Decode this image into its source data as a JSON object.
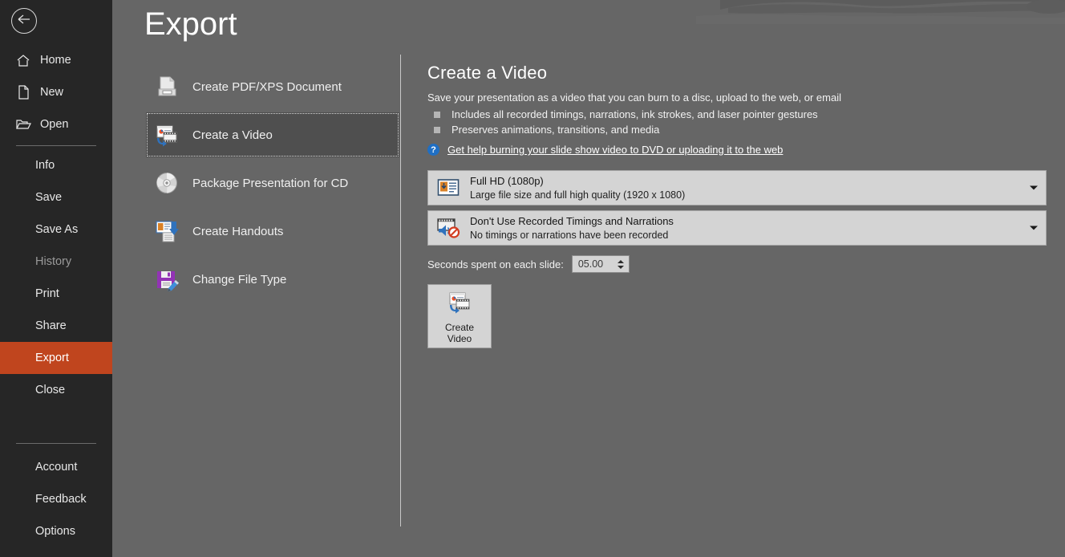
{
  "window": {
    "title": "Export"
  },
  "nav": {
    "back_icon": "back-arrow-icon",
    "top_items": [
      {
        "label": "Home",
        "icon": "home-icon"
      },
      {
        "label": "New",
        "icon": "new-document-icon"
      },
      {
        "label": "Open",
        "icon": "open-folder-icon"
      }
    ],
    "mid_items": [
      {
        "label": "Info",
        "state": "normal"
      },
      {
        "label": "Save",
        "state": "normal"
      },
      {
        "label": "Save As",
        "state": "normal"
      },
      {
        "label": "History",
        "state": "disabled"
      },
      {
        "label": "Print",
        "state": "normal"
      },
      {
        "label": "Share",
        "state": "normal"
      },
      {
        "label": "Export",
        "state": "selected"
      },
      {
        "label": "Close",
        "state": "normal"
      }
    ],
    "bottom_items": [
      {
        "label": "Account"
      },
      {
        "label": "Feedback"
      },
      {
        "label": "Options"
      }
    ],
    "selected_color": "#c0451e",
    "background_color": "#262626"
  },
  "export_options": [
    {
      "label": "Create PDF/XPS Document",
      "icon": "pdf-document-icon",
      "selected": false
    },
    {
      "label": "Create a Video",
      "icon": "create-video-icon",
      "selected": true
    },
    {
      "label": "Package Presentation for CD",
      "icon": "cd-disc-icon",
      "selected": false
    },
    {
      "label": "Create Handouts",
      "icon": "handouts-icon",
      "selected": false
    },
    {
      "label": "Change File Type",
      "icon": "change-file-type-icon",
      "selected": false
    }
  ],
  "detail": {
    "title": "Create a Video",
    "description": "Save your presentation as a video that you can burn to a disc, upload to the web, or email",
    "bullets": [
      "Includes all recorded timings, narrations, ink strokes, and laser pointer gestures",
      "Preserves animations, transitions, and media"
    ],
    "help_link": "Get help burning your slide show video to DVD or uploading it to the web",
    "help_icon": "question-help-icon",
    "quality_combo": {
      "primary": "Full HD (1080p)",
      "secondary": "Large file size and full high quality (1920 x 1080)",
      "icon": "video-quality-icon",
      "arrow_icon": "chevron-down-icon"
    },
    "timings_combo": {
      "primary": "Don't Use Recorded Timings and Narrations",
      "secondary": "No timings or narrations have been recorded",
      "icon": "no-narration-icon",
      "arrow_icon": "chevron-down-icon"
    },
    "seconds": {
      "label": "Seconds spent on each slide:",
      "value": "05.00",
      "up_icon": "spinner-up-icon",
      "down_icon": "spinner-down-icon"
    },
    "create_button": {
      "line1": "Create",
      "line2": "Video",
      "icon": "create-video-icon"
    }
  }
}
